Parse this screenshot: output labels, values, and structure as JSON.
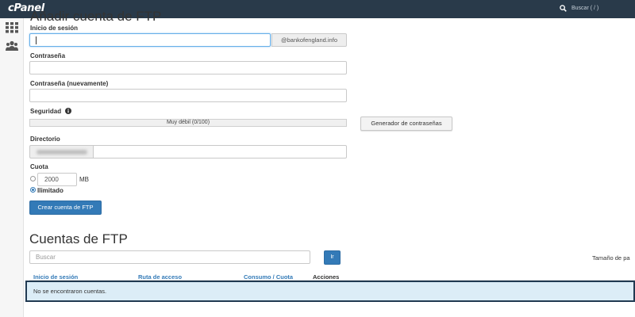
{
  "brand": {
    "logo": "cPanel"
  },
  "header": {
    "search_placeholder": "Buscar ( / )"
  },
  "form": {
    "heading": "Añadir cuenta de FTP",
    "login": {
      "label": "Inicio de sesión",
      "value": "",
      "domain": "@bankofengland.info"
    },
    "password": {
      "label": "Contraseña",
      "value": ""
    },
    "password_again": {
      "label": "Contraseña (nuevamente)",
      "value": ""
    },
    "strength": {
      "label": "Seguridad",
      "meter_text": "Muy débil (0/100)",
      "value": 0
    },
    "generator_button": "Generador de contraseñas",
    "directory": {
      "label": "Directorio",
      "value": ""
    },
    "quota": {
      "label": "Cuota",
      "value": "2000",
      "unit": "MB",
      "unlimited_label": "Ilimitado",
      "selected": "unlimited"
    },
    "submit_button": "Crear cuenta de FTP"
  },
  "accounts": {
    "title": "Cuentas de FTP",
    "search_placeholder": "Buscar",
    "go_button": "Ir",
    "page_size_label": "Tamaño de pa",
    "columns": [
      "Inicio de sesión",
      "Ruta de acceso",
      "Consumo / Cuota",
      "Acciones"
    ],
    "empty_message": "No se encontraron cuentas."
  },
  "colors": {
    "topbar": "#293a4a",
    "primary": "#337ab7",
    "link": "#337ab7",
    "empty_row_bg": "#dcedf7",
    "empty_row_border": "#213a52"
  },
  "icons": [
    "search-icon",
    "grid-icon",
    "users-icon",
    "info-icon"
  ]
}
